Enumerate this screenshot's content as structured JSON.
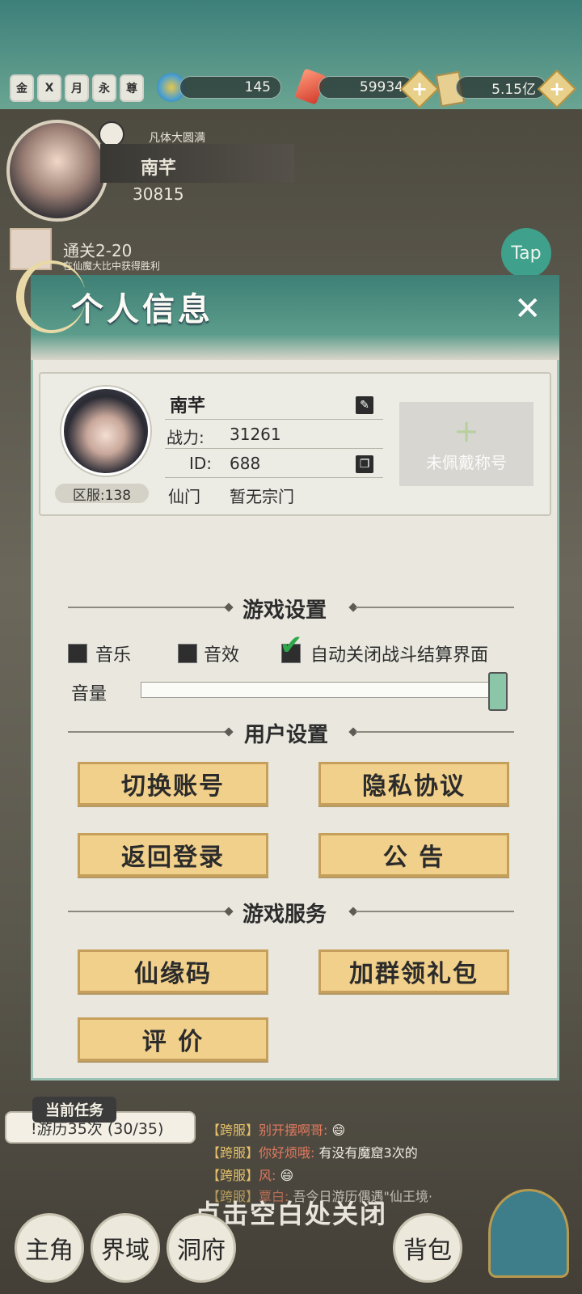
{
  "top_bar": {
    "badges": [
      "金",
      "X",
      "月",
      "永",
      "尊"
    ],
    "energy_value": "145",
    "gem_value": "59934",
    "spirit_value": "5.15亿",
    "plus_symbol": "+"
  },
  "background_player": {
    "realm": "凡体大圆满",
    "name": "南芊",
    "power": "30815",
    "stage_title": "通关2-20",
    "stage_sub": "在仙魔大比中获得胜利",
    "tap_label": "Tap"
  },
  "modal": {
    "title": "个人信息",
    "close_symbol": "✕",
    "profile": {
      "name": "南芊",
      "power_label": "战力:",
      "power_value": "31261",
      "id_label": "ID:",
      "id_value": "688",
      "sect_label": "仙门",
      "sect_value": "暂无宗门",
      "server": "区服:138",
      "title_plus": "+",
      "title_text": "未佩戴称号"
    },
    "game_settings": {
      "heading": "游戏设置",
      "music": {
        "label": "音乐",
        "checked": false
      },
      "sound": {
        "label": "音效",
        "checked": false
      },
      "auto_close": {
        "label": "自动关闭战斗结算界面",
        "checked": true
      },
      "volume_label": "音量",
      "volume_level": 1.0
    },
    "user_settings": {
      "heading": "用户设置",
      "switch_account": "切换账号",
      "privacy": "隐私协议",
      "back_to_login": "返回登录",
      "announcement": "公 告"
    },
    "game_services": {
      "heading": "游戏服务",
      "immortal_code": "仙缘码",
      "join_group": "加群领礼包",
      "rate": "评 价"
    }
  },
  "bottom": {
    "task_label": "当前任务",
    "task_text": "!游历35次 (30/35)",
    "chat": [
      {
        "tag": "【跨服】",
        "who": "别开摆啊哥:",
        "msg": "😄"
      },
      {
        "tag": "【跨服】",
        "who": "你好烦哦:",
        "msg": "有没有魔窟3次的"
      },
      {
        "tag": "【跨服】",
        "who": "风:",
        "msg": "😄"
      },
      {
        "tag": "【跨服】",
        "who": "覃白:",
        "msg": "吾今日游历偶遇\"仙王境·"
      }
    ],
    "close_hint": "点击空白处关闭",
    "nav": [
      "主角",
      "界域",
      "洞府",
      "背包"
    ]
  }
}
